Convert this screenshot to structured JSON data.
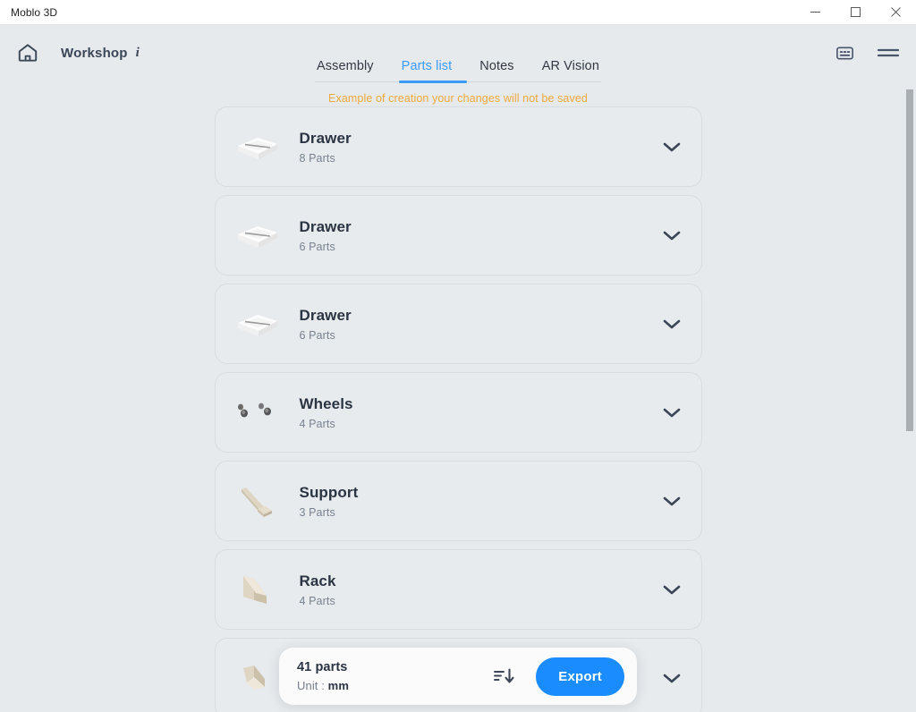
{
  "window": {
    "title": "Moblo 3D",
    "controls": [
      {
        "name": "minimize",
        "label": "—"
      },
      {
        "name": "maximize",
        "label": "□"
      },
      {
        "name": "close",
        "label": "✕"
      }
    ]
  },
  "header": {
    "home_icon": "home-icon",
    "breadcrumb": "Workshop",
    "info_marker": "i",
    "right_icons": [
      {
        "name": "caption-icon"
      },
      {
        "name": "hamburger-menu-icon"
      }
    ]
  },
  "tabs": [
    {
      "label": "Assembly",
      "active": false
    },
    {
      "label": "Parts list",
      "active": true
    },
    {
      "label": "Notes",
      "active": false
    },
    {
      "label": "AR Vision",
      "active": false
    }
  ],
  "warning": "Example of creation your changes will not be saved",
  "parts": [
    {
      "title": "Drawer",
      "subtitle": "8 Parts",
      "thumb": "drawer-thumbnail"
    },
    {
      "title": "Drawer",
      "subtitle": "6 Parts",
      "thumb": "drawer-thumbnail"
    },
    {
      "title": "Drawer",
      "subtitle": "6 Parts",
      "thumb": "drawer-thumbnail"
    },
    {
      "title": "Wheels",
      "subtitle": "4 Parts",
      "thumb": "wheels-thumbnail"
    },
    {
      "title": "Support",
      "subtitle": "3 Parts",
      "thumb": "support-thumbnail"
    },
    {
      "title": "Rack",
      "subtitle": "4 Parts",
      "thumb": "rack-thumbnail"
    },
    {
      "title": "",
      "subtitle": "",
      "thumb": "rack-thumbnail"
    }
  ],
  "summary": {
    "count": "41 parts",
    "unit_label": "Unit :",
    "unit_value": "mm",
    "sort_icon": "sort-descending-icon",
    "export_label": "Export"
  },
  "colors": {
    "background": "#e6eaec",
    "card": "#e7ebed",
    "accent_blue": "#3a9bfd",
    "export_blue": "#1a8cfd",
    "warning_orange": "#efa93f",
    "title_text": "#2b3442",
    "muted_text": "#78828f"
  }
}
